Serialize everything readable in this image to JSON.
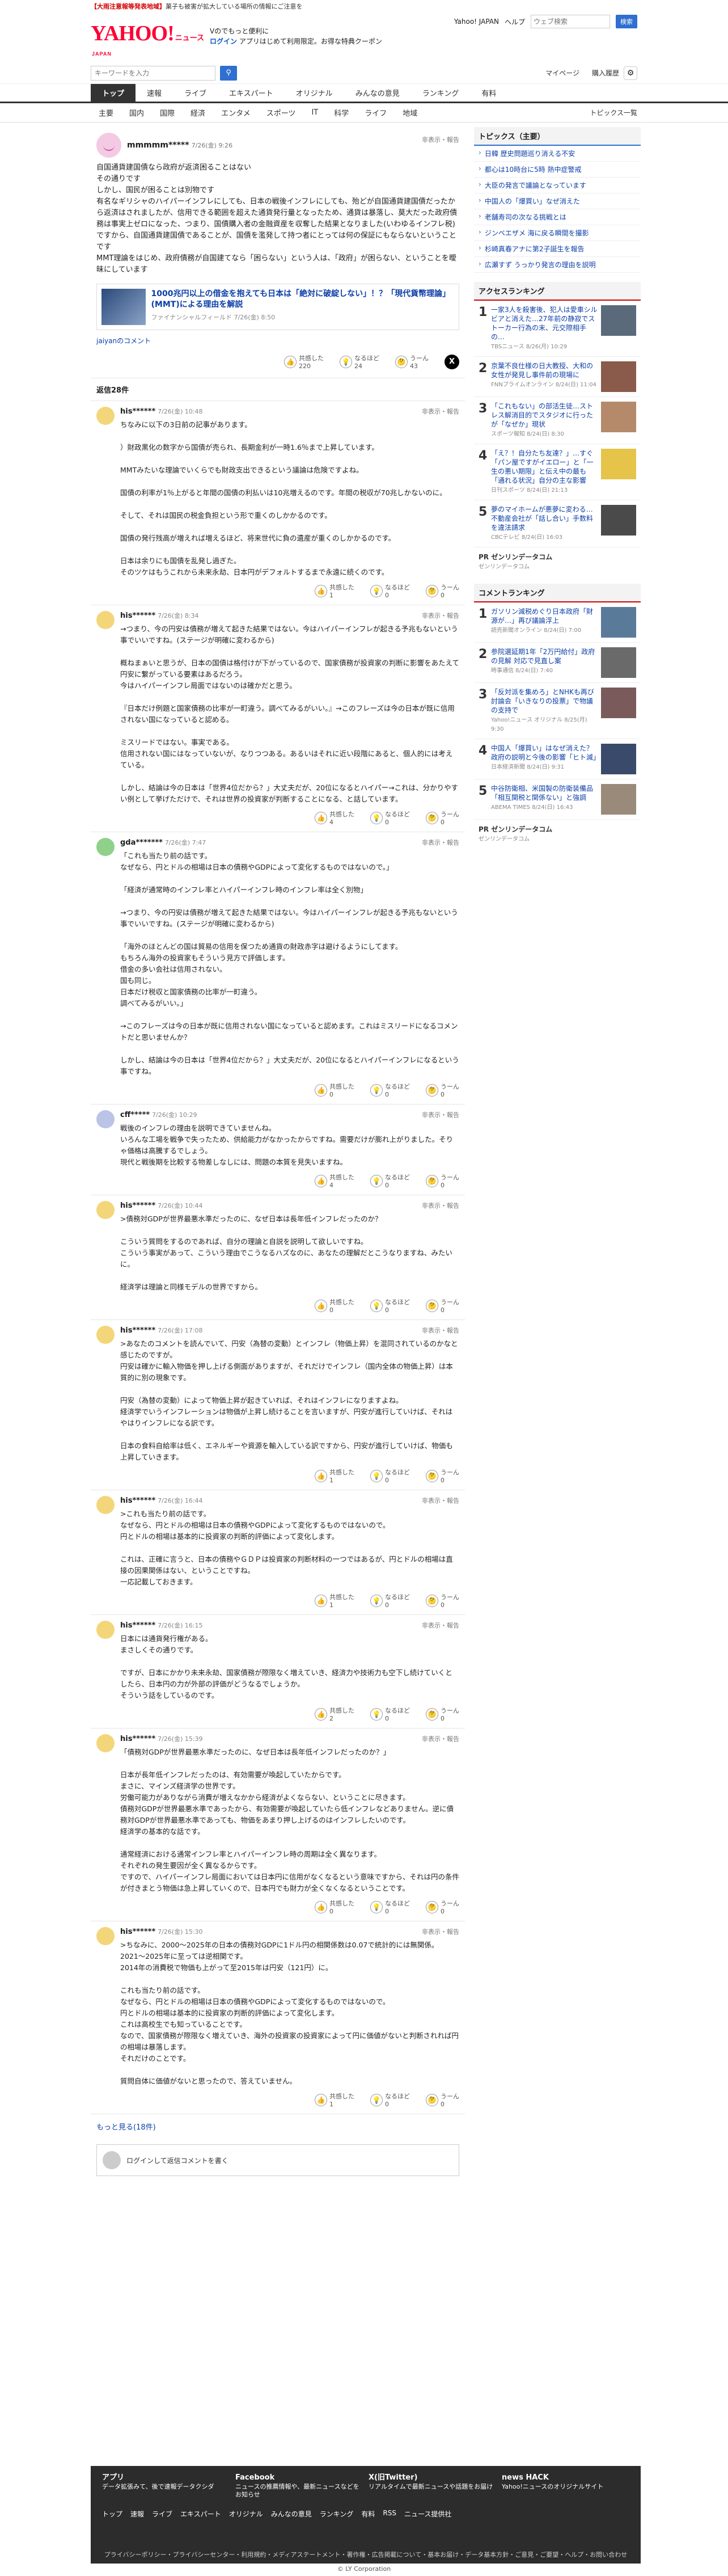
{
  "alert": {
    "text": "【大雨注意報等発表地域】",
    "detail": "菓子も被害が拡大している場所の情報にご注意を",
    "link": ""
  },
  "header": {
    "logo": "YAHOO!",
    "logo_sub": "ニュース",
    "logo_jp": "JAPAN",
    "msg1": "Vのでもっと便利に",
    "msg2": "ログイン",
    "msg3": "アプリはじめて利用限定。お得な特典クーポン",
    "yjapan": "Yahoo! JAPAN",
    "help": "ヘルプ",
    "search_placeholder": "ウェブ検索",
    "search_btn": "検索"
  },
  "row2": {
    "kw_placeholder": "キーワードを入力",
    "mypage": "マイページ",
    "purchase": "購入履歴"
  },
  "nav": [
    "トップ",
    "速報",
    "ライブ",
    "エキスパート",
    "オリジナル",
    "みんなの意見",
    "ランキング",
    "有料"
  ],
  "subnav": [
    "主要",
    "国内",
    "国際",
    "経済",
    "エンタメ",
    "スポーツ",
    "IT",
    "科学",
    "ライフ",
    "地域"
  ],
  "subnav_right": "トピックス一覧",
  "post": {
    "user": "mmmmm*****",
    "time": "7/26(金) 9:26",
    "report": "非表示・報告",
    "body": [
      "自国通貨建国債なら政府が返済困ることはない",
      "その通りです",
      "しかし、国民が困ることは別物です",
      "有名なギリシャのハイパーインフレにしても、日本の戦後インフレにしても、殆どが自国通貨建国債だったから返済はされましたが、信用できる範囲を超えた通貨発行量となったため、通貨は暴落し、莫大だった政府債務は事実上ゼロになった、つまり、国債購入者の金融資産を収奪した結果となりました(いわゆるインフレ税)",
      "ですから、自国通貨建国債であることが、国債を濫発して持つ者にとっては何の保証にもならないということです",
      "MMT理論をはじめ、政府債務が自国建てなら「困らない」という人は、「政府」が困らない、ということを曖昧にしています"
    ],
    "card_title": "1000兆円以上の借金を抱えても日本は「絶対に破綻しない」！？「現代貨幣理論」(MMT)による理由を解説",
    "card_source": "ファイナンシャルフィールド 7/26(金) 8:50",
    "jaiyan": "jaiyanのコメント",
    "likes": "220",
    "likes_l": "共感した",
    "nh": "24",
    "nh_l": "なるほど",
    "dis": "43",
    "dis_l": "うーん"
  },
  "comments_count": "返信28件",
  "comments": [
    {
      "user": "his******",
      "time": "7/26(金) 10:48",
      "avatar": "#f3d67a",
      "text": "ちなみに以下の3日前の記事があります。\n\n）財政黒化の数字から国債が売られ、長期金利が一時1.6％まで上昇しています。\n\nMMTみたいな理論でいくらでも財政支出できるという議論は危険ですよね。\n\n国債の利率が1％上がると年間の国債の利払いは10兆増えるのです。年間の税収が70兆しかないのに。\n\nそして、それは国民の税金負担という形で重くのしかかるのです。\n\n国債の発行残高が増えれば増えるほど、将来世代に負の遺産が重くのしかかるのです。\n\n日本は余りにも国債を乱発し過ぎた。\nそのツケはもうこれから未来永劫、日本円がデフォルトするまで永遠に続くのです。",
      "l": "1",
      "n": "0",
      "d": "0"
    },
    {
      "user": "his******",
      "time": "7/26(金) 8:34",
      "avatar": "#f3d67a",
      "text": "→つまり、今の円安は債務が増えて起きた結果ではない。今はハイパーインフレが起きる予兆もないという事でいいですね。(ステージが明確に変わるから)\n\n概ねまぁいと思うが、日本の国債は格付けが下がっているので、国家債務が投資家の判断に影響をあたえて円安に繋がっている要素はあるだろう。\n今はハイパーインフレ局面ではないのは確かだと思う。\n\n『日本だけ例題と国家債務の比率が一町違う。調べてみるがいい。』→このフレーズは今の日本が既に信用されない国になっていると認める。\n\nミスリードではない。事実である。\n信用されない国にはなっていないが、なりつつある。あるいはそれに近い段階にあると、個人的には考えている。\n\nしかし、結論は今の日本は「世界4位だから？」大丈夫だが、20位になるとハイパー→これは、分かりやすい例として挙げただけで、それは世界の投資家が判断することになる、と話しています。",
      "l": "4",
      "n": "0",
      "d": "0"
    },
    {
      "user": "gda*******",
      "time": "7/26(金) 7:47",
      "avatar": "#8fd08a",
      "text": "「これも当たり前の話です。\nなぜなら、円とドルの相場は日本の債務やGDPによって変化するものではないので。」\n\n「経済が通常時のインフレ率とハイパーインフレ時のインフレ率は全く別物」\n\n→つまり、今の円安は債務が増えて起きた結果ではない。今はハイパーインフレが起きる予兆もないという事でいいですね。(ステージが明確に変わるから)\n\n「海外のほとんどの国は貿易の信用を保つため通貨の財政赤字は避けるようにしてます。\nもちろん海外の投資家もそういう見方で評価します。\n借金の多い会社は信用されない。\n国も同じ。\n日本だけ税収と国家債務の比率が一町違う。\n調べてみるがいい。」\n\n→このフレーズは今の日本が既に信用されない国になっていると認めます。これはミスリードになるコメントだと思いませんか？\n\nしかし、結論は今の日本は「世界4位だから？」大丈夫だが、20位になるとハイパーインフレになるという事ですね。",
      "l": "0",
      "n": "0",
      "d": "0"
    },
    {
      "user": "cff*****",
      "time": "7/26(金) 10:29",
      "avatar": "#b9c4e6",
      "text": "戦後のインフレの理由を説明できていませんね。\nいろんな工場を戦争で失ったため、供給能力がなかったからですね。需要だけが膨れ上がりました。そりゃ価格は高騰するでしょう。\n現代と戦後期を比較する物差しなしには、問題の本質を見失いますね。",
      "l": "4",
      "n": "0",
      "d": "0"
    },
    {
      "user": "his******",
      "time": "7/26(金) 10:44",
      "avatar": "#f3d67a",
      "text": ">債務対GDPが世界最悪水準だったのに、なぜ日本は長年低インフレだったのか？\n\nこういう質問をするのであれば、自分の理論と自説を説明して欲しいですね。\nこういう事実があって、こういう理由でこうなるハズなのに、あなたの理解だとこうなりますね、みたいに。\n\n経済学は理論と同様モデルの世界ですから。",
      "l": "0",
      "n": "0",
      "d": "0"
    },
    {
      "user": "his******",
      "time": "7/26(金) 17:08",
      "avatar": "#f3d67a",
      "text": ">あなたのコメントを読んでいて、円安（為替の変動）とインフレ（物価上昇）を混同されているのかなと感じたのですが。\n円安は確かに輸入物価を押し上げる側面がありますが、それだけでインフレ（国内全体の物価上昇）は本質的に別の現象です。\n\n円安（為替の変動）によって物価上昇が起きていれば、それはインフレになりますよね。\n経済学でいうインフレーションは物価が上昇し続けることを言いますが、円安が進行していけば、それはやはりインフレになる訳です。\n\n日本の食料自給率は低く、エネルギーや資源を輸入している訳ですから、円安が進行していけば、物価も上昇していきます。",
      "l": "1",
      "n": "0",
      "d": "0"
    },
    {
      "user": "his******",
      "time": "7/26(金) 16:44",
      "avatar": "#f3d67a",
      "text": ">これも当たり前の話です。\nなぜなら、円とドルの相場は日本の債務やGDPによって変化するものではないので。\n円とドルの相場は基本的に投資家の判断的評価によって変化します。\n\nこれは、正確に言うと、日本の債務やＧＤＰは投資家の判断材料の一つではあるが、円とドルの相場は直接の因果関係はない、ということですね。\n一応記載しておきます。",
      "l": "1",
      "n": "0",
      "d": "0"
    },
    {
      "user": "his******",
      "time": "7/26(金) 16:15",
      "avatar": "#f3d67a",
      "text": "日本には通貨発行権がある。\nまさしくその通りです。\n\nですが、日本にかかり未来永劫、国家債務が際限なく増えていき、経済力や技術力も空下し続けていくとしたら、日本円の力が外部の評価がどうなるでしょうか。\nそういう話をしているのです。",
      "l": "2",
      "n": "0",
      "d": "0"
    },
    {
      "user": "his******",
      "time": "7/26(金) 15:39",
      "avatar": "#f3d67a",
      "text": "「債務対GDPが世界最悪水準だったのに、なぜ日本は長年低インフレだったのか？」\n\n日本が長年低インフレだったのは、有効需要が喚起していたからです。\nまさに、マインズ経済学の世界です。\n労働可能力がありながら消費が増えなかから経済がよくならない、ということに尽きます。\n債務対GDPが世界最悪水準であったから、有効需要が喚起していたら低インフレなどありません。逆に債務対GDPが世界最悪水準であっても、物価をあまり押し上げるのはインフレしたいのです。\n経済学の基本的な話です。\n\n通常経済における通常インフレ率とハイパーインフレ時の周期は全く異なります。\nそれぞれの発生要因が全く異なるからです。\nですので、ハイパーインフレ局面においては日本円に信用がなくなるという意味ですから、それは円の条件が付きまとう物価は急上昇していくので、日本円でも財力が全くなくなるということです。",
      "l": "0",
      "n": "0",
      "d": "0"
    },
    {
      "user": "his******",
      "time": "7/26(金) 15:30",
      "avatar": "#f3d67a",
      "text": ">ちなみに、2000〜2025年の日本の債務対GDPに1ドル円の相関係数は0.07で統計的には無関係。2021〜2025年に至っては逆相関です。\n2014年の消費税で物価も上がって至2015年は円安（121円）に。\n\nこれも当たり前の話です。\nなぜなら、円とドルの相場は日本の債務やGDPによって変化するものではないので。\n円とドルの相場は基本的に投資家の判断的評価によって変化します。\nこれは高校生でも知っていることです。\nなので、国家債務が際限なく増えていき、海外の投資家の投資家によって円に価値がないと判断されれば円の相場は暴落します。\nそれだけのことです。\n\n質問自体に価値がないと思ったので、答えていません。",
      "l": "1",
      "n": "0",
      "d": "0"
    }
  ],
  "more": "もっと見る(18件)",
  "login_prompt": "ログインして返信コメントを書く",
  "side": {
    "topics_title": "トピックス（主要）",
    "topics": [
      "日韓 歴史問題巡り消える不安",
      "都心は10時台に5時 熱中症警戒",
      "大臣の発言で議論となっています",
      "中国人の「爆買い」なぜ消えた",
      "老舗寿司の次なる挑戦とは",
      "ジンベエザメ 海に戻る瞬間を撮影",
      "杉崎真春アナに第2子誕生を報告",
      "広瀬すず うっかり発言の理由を説明"
    ],
    "access_title": "アクセスランキング",
    "access": [
      {
        "n": "1",
        "t": "一家3人を殺害後、犯人は愛車シルビアと消えた…27年前の静寂でストーカー行為の末、元交際相手の…",
        "m": "TBSニュース 8/26(月) 10:29",
        "c": "#5a6a7a"
      },
      {
        "n": "2",
        "t": "京葉不良仕様の日大教授、大和の女性が発見し事件前の現場に",
        "m": "FNNプライムオンライン 8/24(日) 11:04",
        "c": "#8a5a4a"
      },
      {
        "n": "3",
        "t": "「これもない」の部活生徒…ストレス解消目的でスタジオに行ったが「なぜか」現状",
        "m": "スポーツ報知 8/24(日) 8:30",
        "c": "#b58a6a"
      },
      {
        "n": "4",
        "t": "「え？！自分たち友達？」…すぐ「パン屋ですがイエロー」と「一生の悪い期限」と伝え中の最も「通れる状況」自分の主な影響",
        "m": "日刊スポーツ 8/24(日) 21:13",
        "c": "#e6c44a"
      },
      {
        "n": "5",
        "t": "夢のマイホームが悪夢に変わる…不動産会社が「話し合い」手数料を違法請求",
        "m": "CBCテレビ 8/24(日) 16:03",
        "c": "#4a4a4a"
      }
    ],
    "pr1_title": "PR ゼンリンデータコム",
    "pr1_sub": "ゼンリンデータコム",
    "comment_title": "コメントランキング",
    "comment": [
      {
        "n": "1",
        "t": "ガソリン減税めぐり日本政府「財源が…」再び議論浮上",
        "m": "読売新聞オンライン 8/24(日) 7:00",
        "c": "#5a7a9a"
      },
      {
        "n": "2",
        "t": "参院選延期1年「2万円給付」政府の見解 対応で見直し案",
        "m": "時事通信 8/24(日) 7:40",
        "c": "#6a6a6a"
      },
      {
        "n": "3",
        "t": "「反対派を集めろ」とNHKも再び討論会「いきなりの投票」で物議の支持で",
        "m": "Yahoo!ニュース オリジナル 8/25(月) 9:30",
        "c": "#7a5a5a"
      },
      {
        "n": "4",
        "t": "中国人「爆買い」はなぜ消えた？政府の説明と今後の影響「ヒト減」",
        "m": "日本経済新聞 8/24(日) 9:31",
        "c": "#3a4a6a"
      },
      {
        "n": "5",
        "t": "中谷防衛相、米国製の防衛装備品「相互関税と関係ない」と強調",
        "m": "ABEMA TIMES 8/24(日) 16:43",
        "c": "#9a8a7a"
      }
    ],
    "pr2_title": "PR ゼンリンデータコム",
    "pr2_sub": "ゼンリンデータコム"
  },
  "footer": {
    "cols": [
      {
        "h": "アプリ",
        "t": "データ拡張みて、後で速報データクシダ"
      },
      {
        "h": "Facebook",
        "t": "ニュースの推薦情報や、最新ニュースなどをお知らせ"
      },
      {
        "h": "X(旧Twitter)",
        "t": "リアルタイムで最新ニュースや話題をお届け"
      },
      {
        "h": "news HACK",
        "t": "Yahoo!ニュースのオリジナルサイト"
      }
    ],
    "nav": [
      "トップ",
      "速報",
      "ライブ",
      "エキスパート",
      "オリジナル",
      "みんなの意見",
      "ランキング",
      "有料",
      "RSS",
      "ニュース提供社"
    ],
    "links": "プライバシーポリシー・プライバシーセンター・利用規約・メディアステートメント・著作権・広告掲載について・基本お届け・データ基本方針・ご意見・ご要望・ヘルプ・お問い合わせ",
    "copy": "© LY Corporation"
  }
}
